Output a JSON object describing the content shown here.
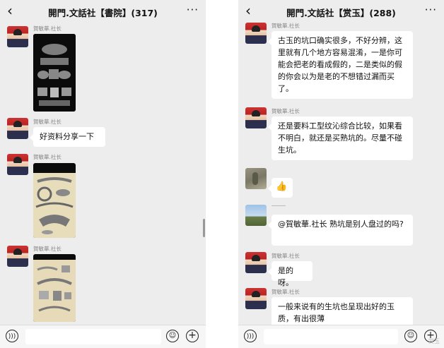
{
  "left": {
    "title": "開門.文話社【書院】(317)",
    "back_icon": "‹",
    "more_icon": "···",
    "sender": "賀敏華.社长",
    "text1": "好资料分享一下"
  },
  "right": {
    "title": "開門.文話社【赏玉】(288)",
    "back_icon": "‹",
    "more_icon": "···",
    "sender": "賀敏華.社长",
    "msg1": "古玉的坑口确实很多，不好分辨，这里就有几个地方容易混淆，一是你可能会把老的看成假的，二是类似的假的你会以为是老的不想错过漏而买了。",
    "msg2": "还是要料工型纹沁综合比较，如果看不明白，就还是买熟坑的。尽量不碰生坑。",
    "msg3": "👍",
    "msg4": "@賀敏華.社长  熟坑是别人盘过的吗?",
    "msg5": "是的呀。",
    "msg6": "一般来说有的生坑也呈现出好的玉质，有出很薄"
  },
  "watermark": "赏玉"
}
